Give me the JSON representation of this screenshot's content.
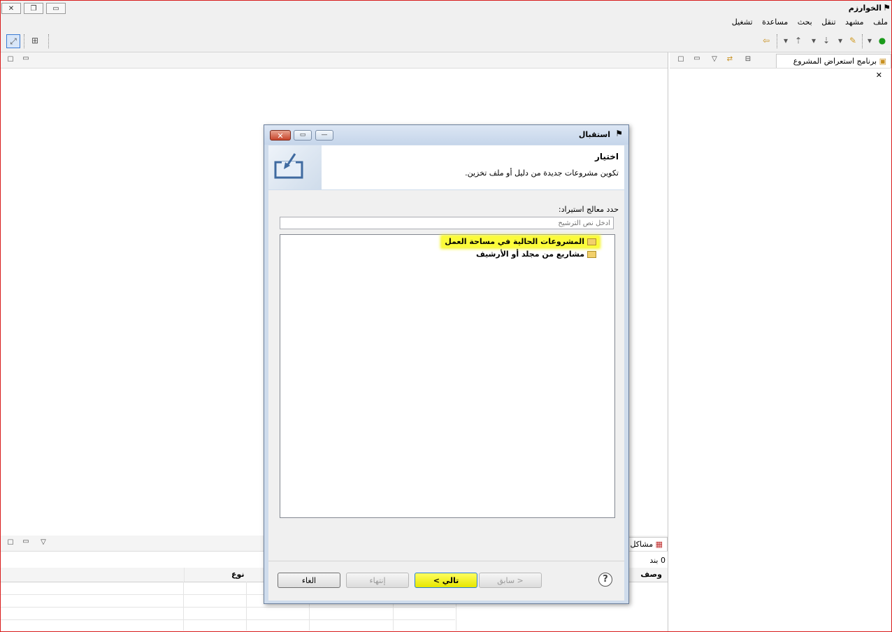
{
  "app": {
    "title": "الخوارزم",
    "window_controls": {
      "close": "✕",
      "restore": "❐",
      "minimize": "▭"
    }
  },
  "menu": [
    "ملف",
    "مشهد",
    "تنقل",
    "بحث",
    "مساعدة",
    "تشغيل"
  ],
  "project_explorer": {
    "tab_label": "برنامج استعراض المشروع"
  },
  "problems_view": {
    "tab_label": "مشاكل",
    "item_count": "0 بند",
    "columns": [
      "وصف",
      "نوع"
    ]
  },
  "dialog": {
    "title": "استقبال",
    "banner_heading": "اختيار",
    "banner_description": "تكوين مشروعات جديدة من دليل أو ملف تخزين.",
    "wizard_label": "حدد معالج استيراد:",
    "filter_placeholder": "أدخل نص الترشيح",
    "items": [
      {
        "label": "المشروعات الحالية في مساحة العمل",
        "selected": true
      },
      {
        "label": "مشاريع من مجلد أو الأرشيف",
        "selected": false
      }
    ],
    "buttons": {
      "cancel": "الغاء",
      "finish": "إنتهاء",
      "next": "تالي >",
      "back": "< سابق",
      "help": "?"
    }
  },
  "colors": {
    "highlight": "#fbfb3a",
    "frame_border": "#d81c1c",
    "dialog_bg": "#cfdcec"
  }
}
